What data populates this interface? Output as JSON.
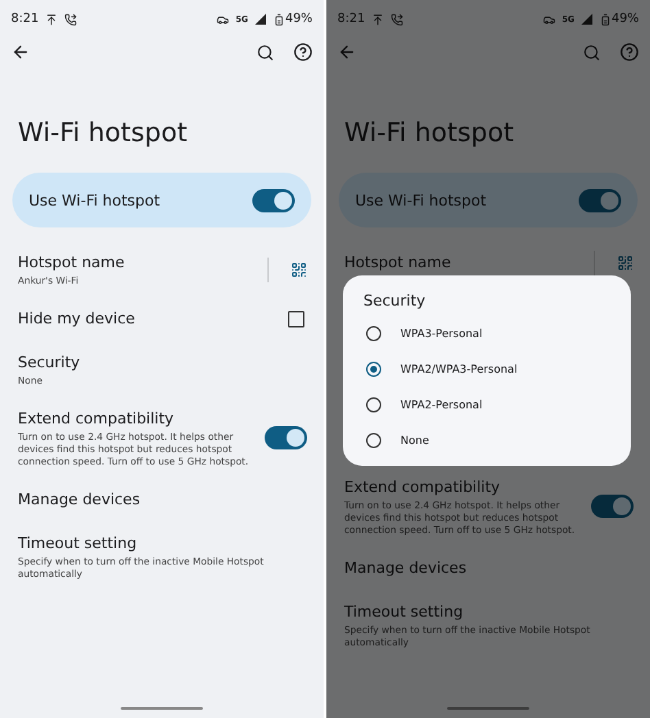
{
  "screens": [
    {
      "dimmed": false,
      "status": {
        "time": "8:21",
        "network": "5G",
        "battery": "49%"
      },
      "title": "Wi-Fi hotspot",
      "main_switch": {
        "label": "Use Wi-Fi hotspot",
        "on": true
      },
      "rows": [
        {
          "kind": "qr",
          "title": "Hotspot name",
          "subtitle": "Ankur's Wi-Fi"
        },
        {
          "kind": "checkbox",
          "title": "Hide my device",
          "checked": false
        },
        {
          "kind": "plain",
          "title": "Security",
          "subtitle": "None"
        },
        {
          "kind": "switch",
          "title": "Extend compatibility",
          "subtitle": "Turn on to use 2.4 GHz hotspot. It helps other devices find this hotspot but reduces hotspot connection speed. Turn off to use 5 GHz hotspot.",
          "on": true
        },
        {
          "kind": "plain",
          "title": "Manage devices"
        },
        {
          "kind": "plain",
          "title": "Timeout setting",
          "subtitle": "Specify when to turn off the inactive Mobile Hotspot automatically"
        }
      ]
    },
    {
      "dimmed": true,
      "status": {
        "time": "8:21",
        "network": "5G",
        "battery": "49%"
      },
      "title": "Wi-Fi hotspot",
      "main_switch": {
        "label": "Use Wi-Fi hotspot",
        "on": true
      },
      "rows": [
        {
          "kind": "qr",
          "title": "Hotspot name"
        },
        {
          "kind": "switch",
          "title": "Extend compatibility",
          "subtitle": "Turn on to use 2.4 GHz hotspot. It helps other devices find this hotspot but reduces hotspot connection speed. Turn off to use 5 GHz hotspot.",
          "on": true
        },
        {
          "kind": "plain",
          "title": "Manage devices"
        },
        {
          "kind": "plain",
          "title": "Timeout setting",
          "subtitle": "Specify when to turn off the inactive Mobile Hotspot automatically"
        }
      ],
      "dialog": {
        "title": "Security",
        "options": [
          {
            "label": "WPA3-Personal",
            "selected": false
          },
          {
            "label": "WPA2/WPA3-Personal",
            "selected": true
          },
          {
            "label": "WPA2-Personal",
            "selected": false
          },
          {
            "label": "None",
            "selected": false
          }
        ]
      }
    }
  ]
}
